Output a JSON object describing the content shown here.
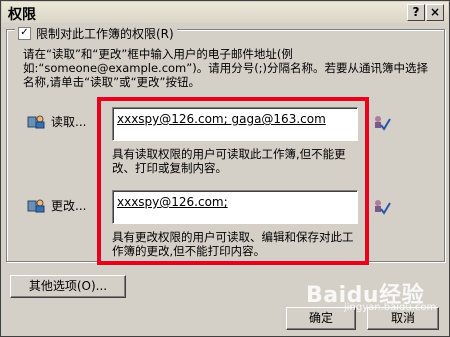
{
  "window": {
    "title": "权限",
    "help_glyph": "?",
    "close_glyph": "×"
  },
  "restrict": {
    "label": "限制对此工作簿的权限(R)",
    "checked": true
  },
  "instructions": "请在“读取”和“更改”框中输入用户的电子邮件地址(例如:“someone@example.com”)。请用分号(;)分隔名称。若要从通讯簿中选择名称,请单击“读取”或“更改”按钮。",
  "read": {
    "button_label": "读取...",
    "value": "xxxspy@126.com; gaga@163.com",
    "description": "具有读取权限的用户可读取此工作簿,但不能更改、打印或复制内容。"
  },
  "change": {
    "button_label": "更改...",
    "value": "xxxspy@126.com;",
    "description": "具有更改权限的用户可读取、编辑和保存对此工作簿的更改,但不能打印内容。"
  },
  "buttons": {
    "more_options": "其他选项(O)...",
    "ok": "确定",
    "cancel": "取消"
  },
  "watermark": {
    "text": "Baidu经验",
    "sub": "jingyan.baidu.com"
  },
  "colors": {
    "highlight": "#e8001c",
    "dialog_bg": "#d4d0c8"
  }
}
